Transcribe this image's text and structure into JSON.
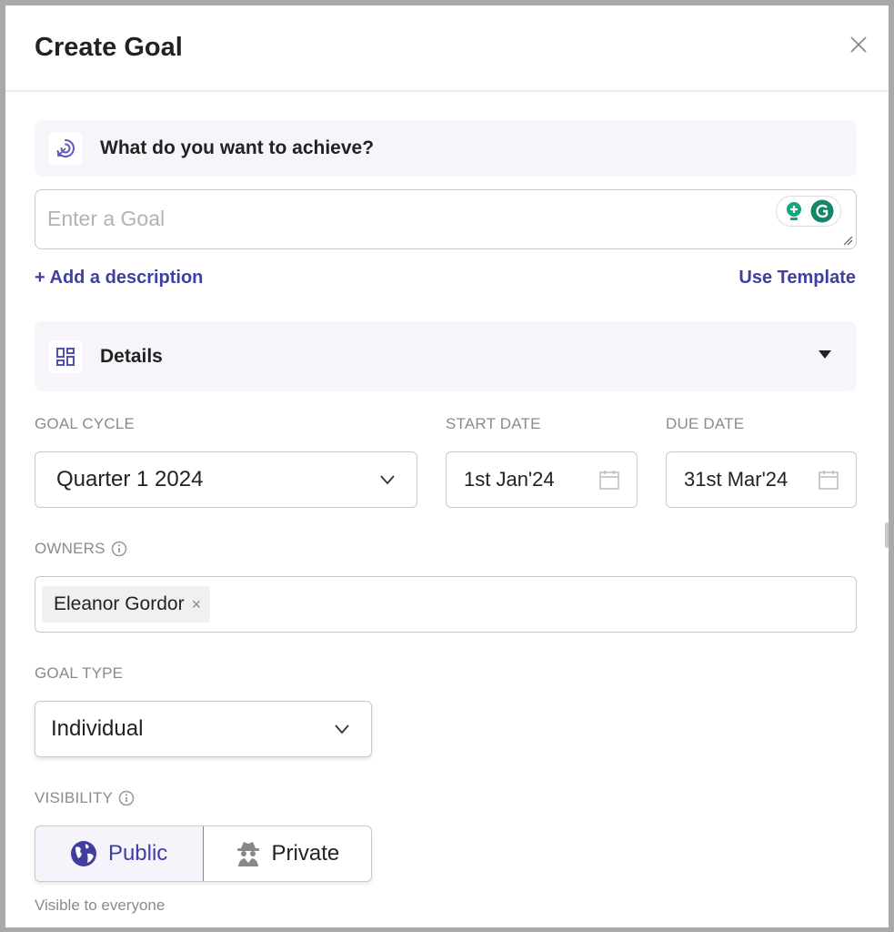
{
  "header": {
    "title": "Create Goal",
    "close_icon": "close-icon"
  },
  "achieve": {
    "icon": "target-icon",
    "label": "What do you want to achieve?"
  },
  "goal_input": {
    "value": "",
    "placeholder": "Enter a Goal",
    "extension_icons": [
      "lightbulb-icon",
      "grammarly-icon"
    ]
  },
  "links": {
    "add_description": "+ Add a description",
    "use_template": "Use Template"
  },
  "details": {
    "icon": "grid-icon",
    "label": "Details",
    "caret_icon": "caret-down-icon"
  },
  "fields": {
    "goal_cycle": {
      "label": "GOAL CYCLE",
      "value": "Quarter 1 2024"
    },
    "start_date": {
      "label": "START DATE",
      "value": "1st Jan'24"
    },
    "due_date": {
      "label": "DUE DATE",
      "value": "31st Mar'24"
    },
    "owners": {
      "label": "OWNERS",
      "chips": [
        {
          "name": "Eleanor Gordor",
          "remove": "×"
        }
      ]
    },
    "goal_type": {
      "label": "GOAL TYPE",
      "value": "Individual"
    },
    "visibility": {
      "label": "VISIBILITY",
      "options": [
        {
          "label": "Public",
          "icon": "globe-icon",
          "selected": true
        },
        {
          "label": "Private",
          "icon": "incognito-icon",
          "selected": false
        }
      ],
      "helper": "Visible to everyone"
    }
  },
  "colors": {
    "accent": "#3e3fa0",
    "section_bg": "#f6f6fa",
    "label": "#8a8a92",
    "grammarly": "#15866a"
  }
}
